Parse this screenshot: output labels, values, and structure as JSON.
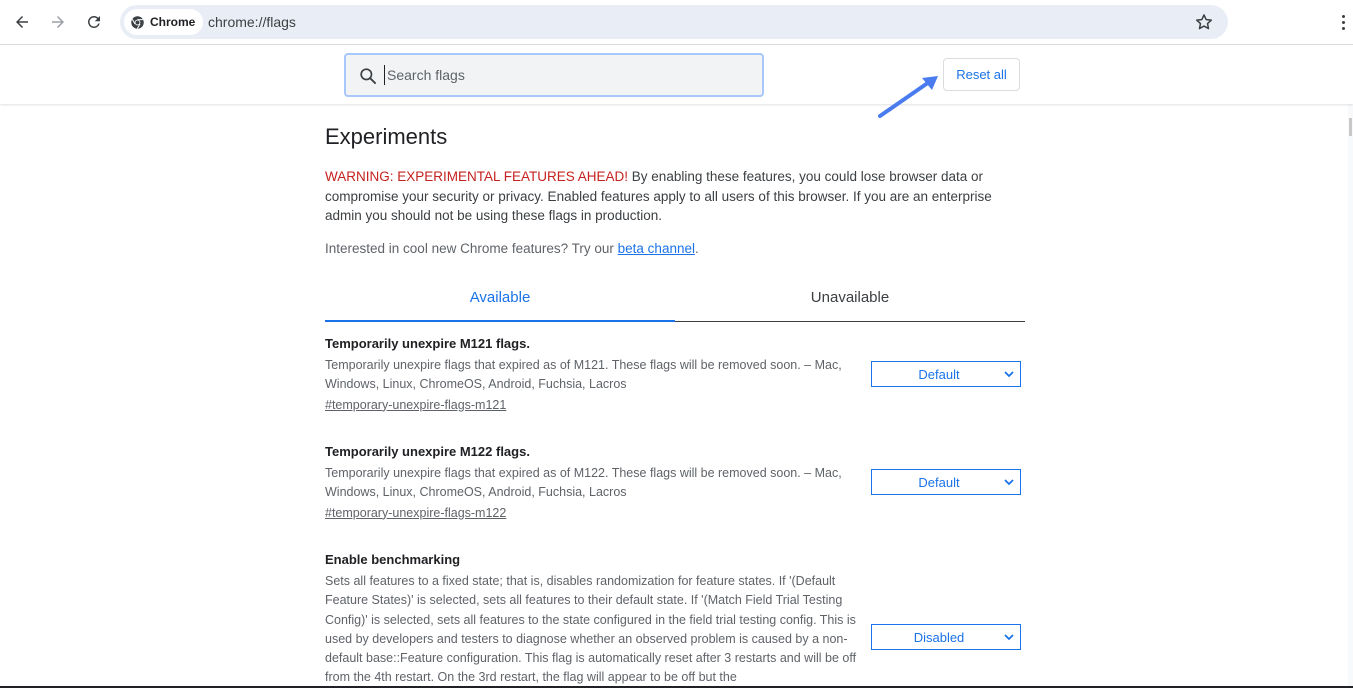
{
  "browser": {
    "chip_label": "Chrome",
    "url": "chrome://flags"
  },
  "header": {
    "search_placeholder": "Search flags",
    "reset_label": "Reset all"
  },
  "main": {
    "title": "Experiments",
    "warning_red": "WARNING: EXPERIMENTAL FEATURES AHEAD!",
    "warning_text": " By enabling these features, you could lose browser data or compromise your security or privacy. Enabled features apply to all users of this browser. If you are an enterprise admin you should not be using these flags in production.",
    "interest_text": "Interested in cool new Chrome features? Try our ",
    "beta_link": "beta channel",
    "interest_end": ".",
    "tabs": [
      {
        "label": "Available"
      },
      {
        "label": "Unavailable"
      }
    ],
    "flags": [
      {
        "title": "Temporarily unexpire M121 flags.",
        "description": "Temporarily unexpire flags that expired as of M121. These flags will be removed soon. – Mac, Windows, Linux, ChromeOS, Android, Fuchsia, Lacros",
        "link": "#temporary-unexpire-flags-m121",
        "value": "Default"
      },
      {
        "title": "Temporarily unexpire M122 flags.",
        "description": "Temporarily unexpire flags that expired as of M122. These flags will be removed soon. – Mac, Windows, Linux, ChromeOS, Android, Fuchsia, Lacros",
        "link": "#temporary-unexpire-flags-m122",
        "value": "Default"
      },
      {
        "title": "Enable benchmarking",
        "description": "Sets all features to a fixed state; that is, disables randomization for feature states. If '(Default Feature States)' is selected, sets all features to their default state. If '(Match Field Trial Testing Config)' is selected, sets all features to the state configured in the field trial testing config. This is used by developers and testers to diagnose whether an observed problem is caused by a non-default base::Feature configuration. This flag is automatically reset after 3 restarts and will be off from the 4th restart. On the 3rd restart, the flag will appear to be off but the",
        "value": "Disabled"
      }
    ]
  },
  "colors": {
    "accent": "#1a73e8",
    "warning": "#c5221f",
    "annotation_arrow": "#4a7cf0"
  }
}
